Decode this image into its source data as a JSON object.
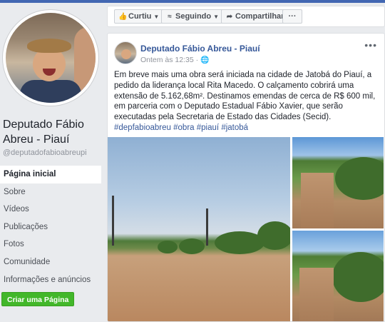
{
  "page": {
    "name": "Deputado Fábio Abreu - Piauí",
    "handle": "@deputadofabioabreupi"
  },
  "nav": {
    "items": [
      {
        "label": "Página inicial",
        "active": true
      },
      {
        "label": "Sobre"
      },
      {
        "label": "Vídeos"
      },
      {
        "label": "Publicações"
      },
      {
        "label": "Fotos"
      },
      {
        "label": "Comunidade"
      },
      {
        "label": "Informações e anúncios"
      }
    ],
    "create_page_label": "Criar uma Página"
  },
  "actions": {
    "like_label": "Curtiu",
    "follow_label": "Seguindo",
    "share_label": "Compartilhar",
    "more_label": "···"
  },
  "post": {
    "author": "Deputado Fábio Abreu - Piauí",
    "time": "Ontem às 12:35 ·",
    "menu": "•••",
    "text_plain": "Em breve mais uma obra será iniciada na cidade de Jatobá do Piauí, a pedido da liderança local Rita Macedo. O calçamento cobrirá uma extensão de 5.162,68m². Destinamos emendas de cerca de R$ 600 mil, em parceria com o Deputado Estadual Fábio Xavier, que serão executadas pela Secretaria de Estado das Cidades (Secid).",
    "hashtags": [
      "#depfabioabreu",
      "#obra",
      "#piauí",
      "#jatobá"
    ]
  },
  "colors": {
    "brand": "#4267b2",
    "link": "#365899",
    "create_button": "#42b72a"
  },
  "icons": {
    "like": "thumbs-up-icon",
    "follow": "rss-icon",
    "share": "share-arrow-icon",
    "globe": "globe-icon"
  }
}
